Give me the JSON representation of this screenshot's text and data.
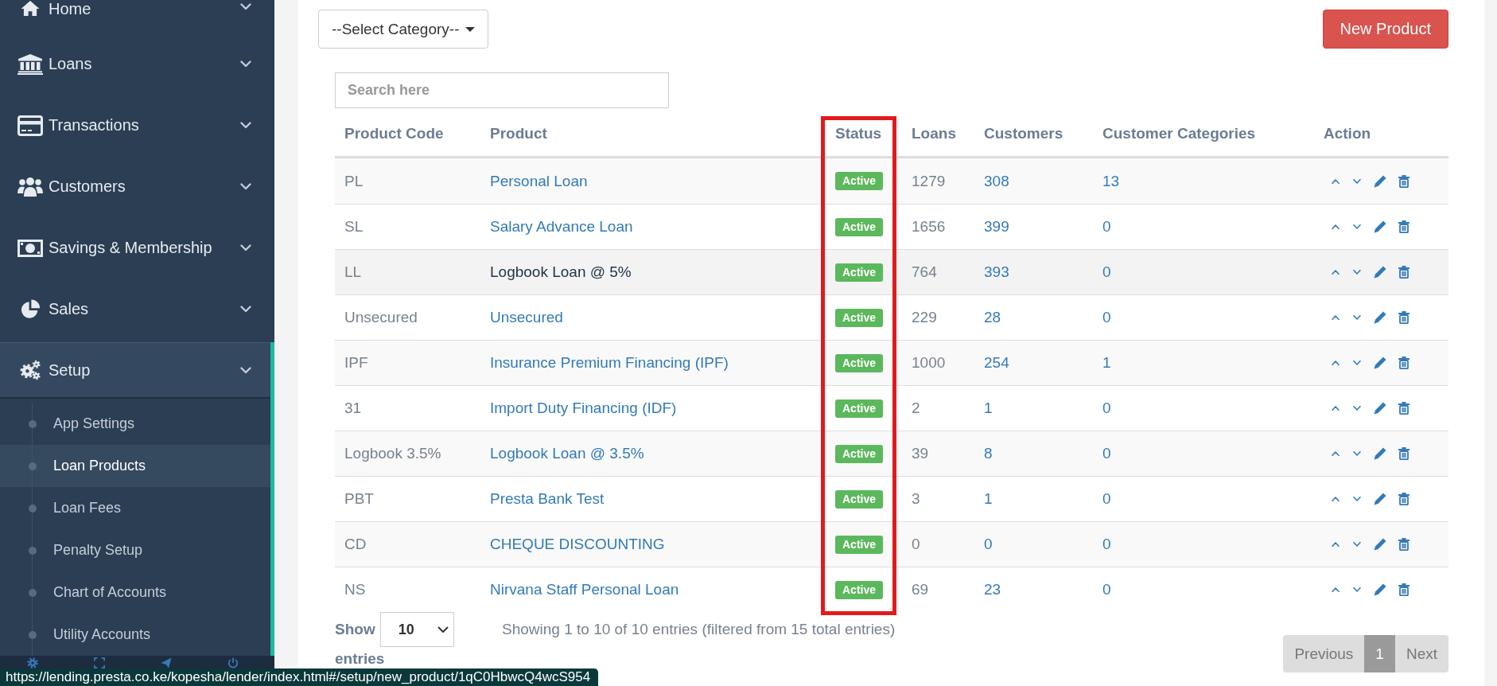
{
  "sidebar": {
    "items": [
      {
        "label": "Home",
        "expanded": false
      },
      {
        "label": "Loans",
        "expanded": false
      },
      {
        "label": "Transactions",
        "expanded": false
      },
      {
        "label": "Customers",
        "expanded": false
      },
      {
        "label": "Savings & Membership",
        "expanded": false
      },
      {
        "label": "Sales",
        "expanded": false
      },
      {
        "label": "Setup",
        "expanded": true,
        "children": [
          {
            "label": "App Settings",
            "selected": false
          },
          {
            "label": "Loan Products",
            "selected": true
          },
          {
            "label": "Loan Fees",
            "selected": false
          },
          {
            "label": "Penalty Setup",
            "selected": false
          },
          {
            "label": "Chart of Accounts",
            "selected": false
          },
          {
            "label": "Utility Accounts",
            "selected": false
          }
        ]
      }
    ]
  },
  "toolbar": {
    "category_dropdown": {
      "label": "--Select Category--"
    },
    "new_product_button": "New Product"
  },
  "search": {
    "placeholder": "Search here"
  },
  "table": {
    "columns": [
      {
        "label": "Product Code",
        "highlighted": false
      },
      {
        "label": "Product",
        "highlighted": false
      },
      {
        "label": "Status",
        "highlighted": true
      },
      {
        "label": "Loans",
        "highlighted": false
      },
      {
        "label": "Customers",
        "highlighted": false
      },
      {
        "label": "Customer Categories",
        "highlighted": false
      },
      {
        "label": "Action",
        "highlighted": false
      }
    ],
    "rows": [
      {
        "code": "PL",
        "product": "Personal Loan",
        "status": "Active",
        "loans": "1279",
        "customers": "308",
        "customer_categories": "13",
        "hovered": false
      },
      {
        "code": "SL",
        "product": "Salary Advance Loan",
        "status": "Active",
        "loans": "1656",
        "customers": "399",
        "customer_categories": "0",
        "hovered": false
      },
      {
        "code": "LL",
        "product": "Logbook Loan @ 5%",
        "status": "Active",
        "loans": "764",
        "customers": "393",
        "customer_categories": "0",
        "hovered": true
      },
      {
        "code": "Unsecured",
        "product": "Unsecured",
        "status": "Active",
        "loans": "229",
        "customers": "28",
        "customer_categories": "0",
        "hovered": false
      },
      {
        "code": "IPF",
        "product": "Insurance Premium Financing (IPF)",
        "status": "Active",
        "loans": "1000",
        "customers": "254",
        "customer_categories": "1",
        "hovered": false
      },
      {
        "code": "31",
        "product": "Import Duty Financing (IDF)",
        "status": "Active",
        "loans": "2",
        "customers": "1",
        "customer_categories": "0",
        "hovered": false
      },
      {
        "code": "Logbook 3.5%",
        "product": "Logbook Loan @ 3.5%",
        "status": "Active",
        "loans": "39",
        "customers": "8",
        "customer_categories": "0",
        "hovered": false
      },
      {
        "code": "PBT",
        "product": "Presta Bank Test",
        "status": "Active",
        "loans": "3",
        "customers": "1",
        "customer_categories": "0",
        "hovered": false
      },
      {
        "code": "CD",
        "product": "CHEQUE DISCOUNTING",
        "status": "Active",
        "loans": "0",
        "customers": "0",
        "customer_categories": "0",
        "hovered": false
      },
      {
        "code": "NS",
        "product": "Nirvana Staff Personal Loan",
        "status": "Active",
        "loans": "69",
        "customers": "23",
        "customer_categories": "0",
        "hovered": false
      }
    ]
  },
  "table_footer": {
    "length_menu": {
      "prefix": "Show",
      "value": "10",
      "suffix": "entries"
    },
    "info": "Showing 1 to 10 of 10 entries (filtered from 15 total entries)",
    "pagination": {
      "previous": "Previous",
      "pages": [
        {
          "label": "1",
          "selected": true
        }
      ],
      "next": "Next"
    }
  },
  "status_url": "https://lending.presta.co.ke/kopesha/lender/index.html#/setup/new_product/1qC0HbwcQ4wcS954"
}
